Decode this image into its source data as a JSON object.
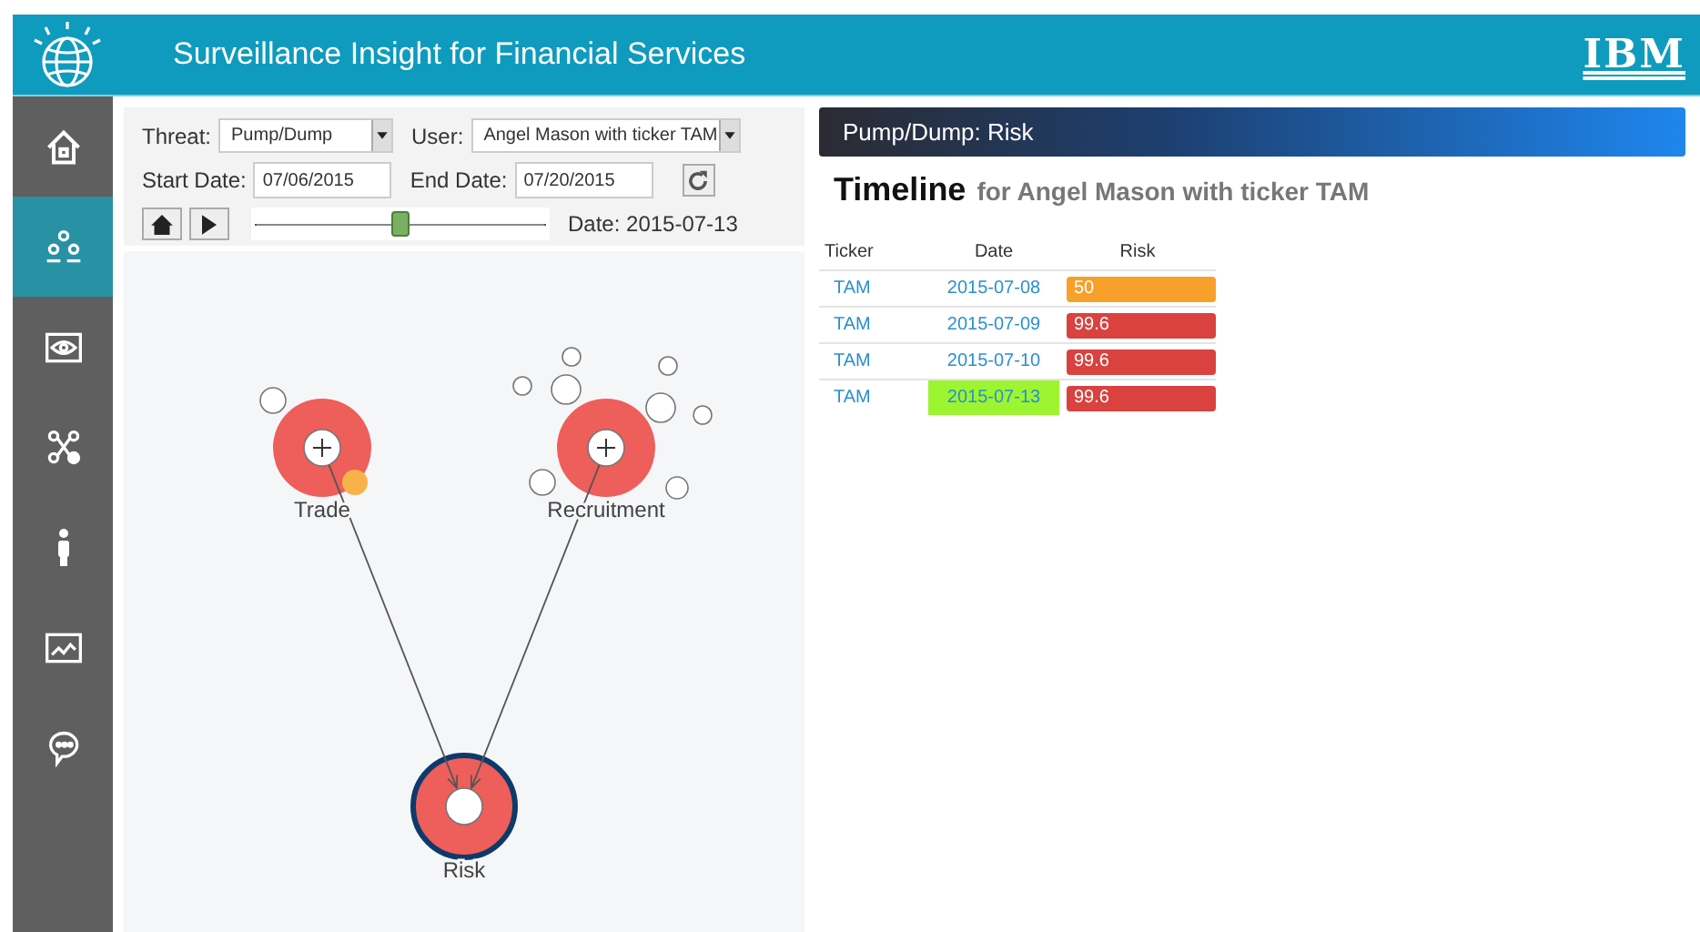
{
  "header": {
    "title": "Surveillance Insight for Financial Services",
    "brand": "IBM"
  },
  "sidebar": {
    "items": [
      {
        "kind": "home",
        "selected": false
      },
      {
        "kind": "people",
        "selected": true
      },
      {
        "kind": "eye",
        "selected": false
      },
      {
        "kind": "network",
        "selected": false
      },
      {
        "kind": "person",
        "selected": false
      },
      {
        "kind": "chart",
        "selected": false
      },
      {
        "kind": "chat",
        "selected": false
      }
    ]
  },
  "filters": {
    "threat_label": "Threat:",
    "threat": "Pump/Dump",
    "user_label": "User:",
    "user": "Angel Mason with ticker TAM",
    "start_label": "Start Date:",
    "start": "07/06/2015",
    "end_label": "End Date:",
    "end": "07/20/2015",
    "slider": {
      "level": 0.5
    },
    "date": "Date: 2015-07-13"
  },
  "graph": {
    "nodes": [
      {
        "label": "Trade",
        "kind": "expandable"
      },
      {
        "label": "Recruitment",
        "kind": "expandable"
      },
      {
        "label": "Risk",
        "kind": "target"
      }
    ]
  },
  "panel": {
    "title": "Pump/Dump: Risk",
    "heading": "Timeline",
    "subheading": "for Angel Mason with ticker TAM"
  },
  "table": {
    "columns": [
      "Ticker",
      "Date",
      "Risk"
    ],
    "rows": [
      {
        "ticker": "TAM",
        "date": "2015-07-08",
        "risk": "50",
        "color": "#f7a02a",
        "selected": false
      },
      {
        "ticker": "TAM",
        "date": "2015-07-09",
        "risk": "99.6",
        "color": "#d9423f",
        "selected": false
      },
      {
        "ticker": "TAM",
        "date": "2015-07-10",
        "risk": "99.6",
        "color": "#d9423f",
        "selected": false
      },
      {
        "ticker": "TAM",
        "date": "2015-07-13",
        "risk": "99.6",
        "color": "#d9423f",
        "selected": true
      }
    ]
  }
}
